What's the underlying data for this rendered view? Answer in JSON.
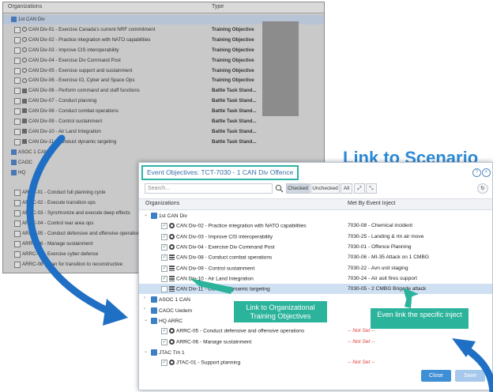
{
  "background_window": {
    "col_org": "Organizations",
    "col_type": "Type",
    "rows": [
      {
        "name": "1st CAN Div",
        "icon": "org",
        "indent": 0,
        "type": "",
        "sel": true
      },
      {
        "name": "CAN Div-01 - Exercise Canada's current NRF commitment",
        "icon": "objective",
        "indent": 1,
        "type": "Training Objective"
      },
      {
        "name": "CAN Div-02 - Practice integration with NATO capabilities",
        "icon": "objective",
        "indent": 1,
        "type": "Training Objective"
      },
      {
        "name": "CAN Div-03 - Improve CIS interoperability",
        "icon": "objective",
        "indent": 1,
        "type": "Training Objective"
      },
      {
        "name": "CAN Div-04 - Exercise Div Command Post",
        "icon": "objective",
        "indent": 1,
        "type": "Training Objective"
      },
      {
        "name": "CAN Div-05 - Exercise support and sustainment",
        "icon": "objective",
        "indent": 1,
        "type": "Training Objective"
      },
      {
        "name": "CAN Div-06 - Exercise IO, Cyber and Space Ops",
        "icon": "objective",
        "indent": 1,
        "type": "Training Objective"
      },
      {
        "name": "CAN Div-06 - Perform command and staff functions",
        "icon": "battle",
        "indent": 1,
        "type": "Battle Task Stand..."
      },
      {
        "name": "CAN Div-07 - Conduct planning",
        "icon": "battle",
        "indent": 1,
        "type": "Battle Task Stand..."
      },
      {
        "name": "CAN Div-08 - Conduct combat operations",
        "icon": "battle",
        "indent": 1,
        "type": "Battle Task Stand..."
      },
      {
        "name": "CAN Div-09 - Control sustainment",
        "icon": "battle",
        "indent": 1,
        "type": "Battle Task Stand..."
      },
      {
        "name": "CAN Div-10 - Air Land Integration",
        "icon": "battle",
        "indent": 1,
        "type": "Battle Task Stand..."
      },
      {
        "name": "CAN Div-11 - Conduct dynamic targeting",
        "icon": "battle",
        "indent": 1,
        "type": "Battle Task Stand..."
      },
      {
        "name": "ASOC 1 CAN",
        "icon": "org",
        "indent": 0,
        "type": ""
      },
      {
        "name": "CAOC",
        "icon": "org",
        "indent": 0,
        "type": ""
      },
      {
        "name": "HQ",
        "icon": "org",
        "indent": 0,
        "type": ""
      },
      {
        "name": "",
        "icon": "",
        "indent": 0,
        "type": ""
      },
      {
        "name": "ARRC-01 - Conduct full planning cycle",
        "icon": "",
        "indent": 1,
        "type": ""
      },
      {
        "name": "ARRC-02 - Execute transition ops",
        "icon": "",
        "indent": 1,
        "type": ""
      },
      {
        "name": "ARRC-03 - Synchronize and execute deep effects",
        "icon": "",
        "indent": 1,
        "type": ""
      },
      {
        "name": "ARRC-04 - Control rear area ops",
        "icon": "",
        "indent": 1,
        "type": ""
      },
      {
        "name": "ARRC-05 - Conduct defensive and offensive operations",
        "icon": "",
        "indent": 1,
        "type": ""
      },
      {
        "name": "ARRC-06 - Manage sustainment",
        "icon": "",
        "indent": 1,
        "type": ""
      },
      {
        "name": "ARRC-07 - Exercise cyber defence",
        "icon": "",
        "indent": 1,
        "type": ""
      },
      {
        "name": "ARRC-08 - Plan for transition to reconstructive",
        "icon": "",
        "indent": 1,
        "type": ""
      }
    ]
  },
  "heading": "Link to Scenario",
  "dialog": {
    "title": "Event Objectives: TCT-7030 - 1 CAN Div Offence",
    "search_placeholder": "Search...",
    "filters": [
      "Checked",
      "Unchecked",
      "All"
    ],
    "col_org": "Organizations",
    "col_event": "Met By Event Inject",
    "rows": [
      {
        "name": "1st CAN Div",
        "kind": "org",
        "indent": 0,
        "event": "",
        "check": false
      },
      {
        "name": "CAN Div-02 - Practice integration with NATO capabilities",
        "kind": "objective",
        "indent": 2,
        "event": "7030-08 - Chemical incident",
        "check": true
      },
      {
        "name": "CAN Div-03 - Improve CIS interoperability",
        "kind": "objective",
        "indent": 2,
        "event": "7030-25 - Landing & rtn air move",
        "check": true
      },
      {
        "name": "CAN Div-04 - Exercise Div Command Post",
        "kind": "objective",
        "indent": 2,
        "event": "7030-01 - Offence Planning",
        "check": true
      },
      {
        "name": "CAN Div-08 - Conduct combat operations",
        "kind": "battle",
        "indent": 2,
        "event": "7030-06 - MI-35 Attack on 1 CMBG",
        "check": true
      },
      {
        "name": "CAN Div-09 - Control sustainment",
        "kind": "battle",
        "indent": 2,
        "event": "7030-22 - Avn unit staging",
        "check": true
      },
      {
        "name": "CAN Div-10 - Air Land Integration",
        "kind": "battle",
        "indent": 2,
        "event": "7030-24 - Air asit fires support",
        "check": true
      },
      {
        "name": "CAN Div-11 - Conduct dynamic targeting",
        "kind": "battle",
        "indent": 2,
        "event": "7030-05 - 2 CMBG Brigade attack",
        "check": false,
        "sel": true
      },
      {
        "name": "ASOC 1 CAN",
        "kind": "org",
        "indent": 0,
        "event": "",
        "collapsed": true
      },
      {
        "name": "CAOC Uedem",
        "kind": "org",
        "indent": 0,
        "event": "",
        "collapsed": true
      },
      {
        "name": "HQ ARRC",
        "kind": "org",
        "indent": 0,
        "event": ""
      },
      {
        "name": "ARRC-05 - Conduct defensive and offensive operations",
        "kind": "objective",
        "indent": 2,
        "event": "-- Not Set --",
        "notset": true,
        "check": true
      },
      {
        "name": "ARRC-06 - Manage sustainment",
        "kind": "objective",
        "indent": 2,
        "event": "-- Not Set --",
        "notset": true,
        "check": true
      },
      {
        "name": "JTAC Tm 1",
        "kind": "org",
        "indent": 0,
        "event": ""
      },
      {
        "name": "JTAC-01 - Support planning",
        "kind": "objective",
        "indent": 2,
        "event": "-- Not Set --",
        "notset": true,
        "check": true
      }
    ],
    "close_label": "Close",
    "save_label": "Save"
  },
  "callouts": {
    "org_objectives": "Link to Organizational Training Objectives",
    "inject": "Even link the specific inject"
  },
  "colors": {
    "accent": "#2d8bd8",
    "callout": "#2bb39b",
    "arrow": "#1f6fc4",
    "notset": "#e03a3a"
  }
}
